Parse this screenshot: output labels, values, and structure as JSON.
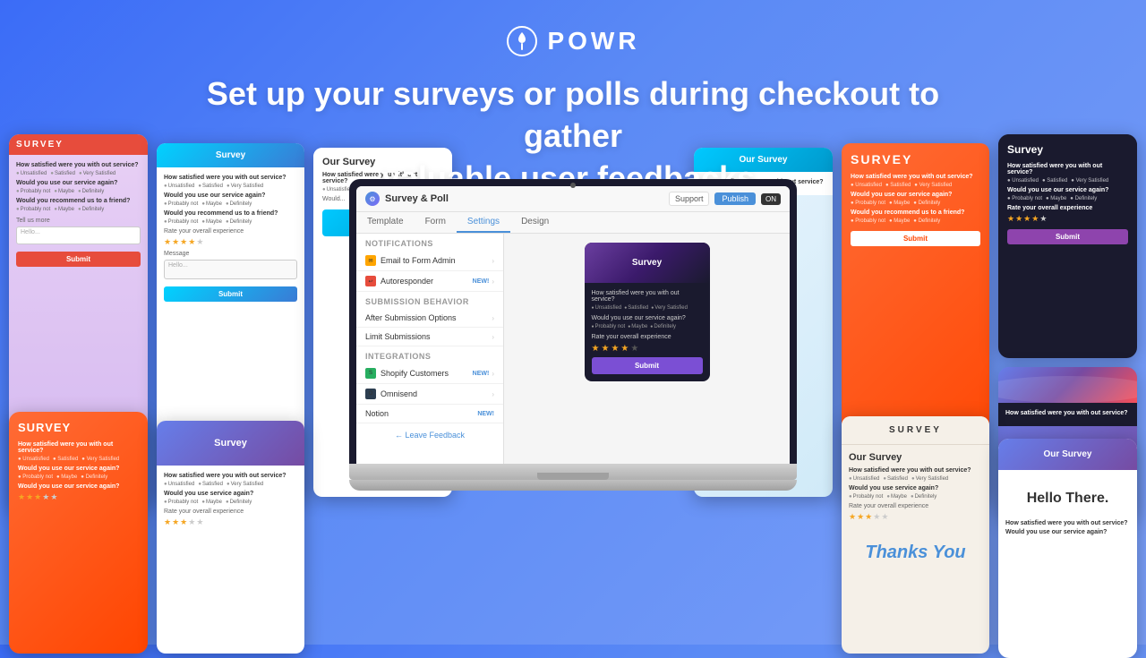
{
  "brand": {
    "logo_text": "POWR",
    "logo_icon": "⚙"
  },
  "header": {
    "headline_line1": "Set up your surveys or polls during checkout to gather",
    "headline_line2": "valuable user feedbacks."
  },
  "app": {
    "title": "Survey & Poll",
    "support_btn": "Support",
    "publish_btn": "Publish",
    "on_toggle": "ON",
    "tabs": [
      "Template",
      "Form",
      "Settings",
      "Design"
    ],
    "active_tab": "Settings",
    "sections": {
      "notifications": {
        "label": "Notifications",
        "items": [
          {
            "label": "Email to Form Admin",
            "icon_type": "orange",
            "new": false
          },
          {
            "label": "Autoresponder",
            "icon_type": "red",
            "new": true
          }
        ]
      },
      "submission": {
        "label": "Submission Behavior",
        "items": [
          {
            "label": "After Submission Options",
            "new": false
          },
          {
            "label": "Limit Submissions",
            "new": false
          }
        ]
      },
      "integrations": {
        "label": "Integrations",
        "items": [
          {
            "label": "Shopify Customers",
            "icon_type": "green",
            "new": true
          },
          {
            "label": "Omnisend",
            "icon_type": "dark",
            "new": false
          },
          {
            "label": "Notion",
            "new": true
          }
        ]
      }
    },
    "feedback_link": "← Leave Feedback"
  },
  "survey_preview": {
    "title": "Survey",
    "question1": "How satisfied were you with out service?",
    "options1": [
      "Unsatisfied",
      "Satisfied",
      "Very Satisfied"
    ],
    "question2": "Would you use our service again?",
    "options2": [
      "Probably not",
      "Maybe",
      "Definitely"
    ],
    "question3": "Rate your overall experience",
    "stars": [
      true,
      true,
      true,
      true,
      false
    ],
    "submit": "Submit"
  },
  "side_cards": {
    "card1": {
      "header": "SURVEY",
      "question1": "How satisfied were you with out service?",
      "options1": [
        "Unsatisfied",
        "Satisfied",
        "Very Satisfied"
      ],
      "question2": "Would you use our service again?",
      "options2": [
        "Probably not",
        "Maybe",
        "Definitely"
      ],
      "question3": "Would you recommend us to a friend?",
      "options3": [
        "Probably not",
        "Maybe",
        "Definitely"
      ]
    },
    "card2": {
      "header": "Survey",
      "question1": "How satisfied were you with out service?",
      "question2": "Would you use our service again?",
      "question3": "Would you recommend us to a friend?",
      "submit": "Submit"
    },
    "card3": {
      "header": "Our Survey",
      "question1": "How satisfied were you with out service?"
    },
    "thanks_you": "Thanks You",
    "hello_there": "Hello There."
  }
}
